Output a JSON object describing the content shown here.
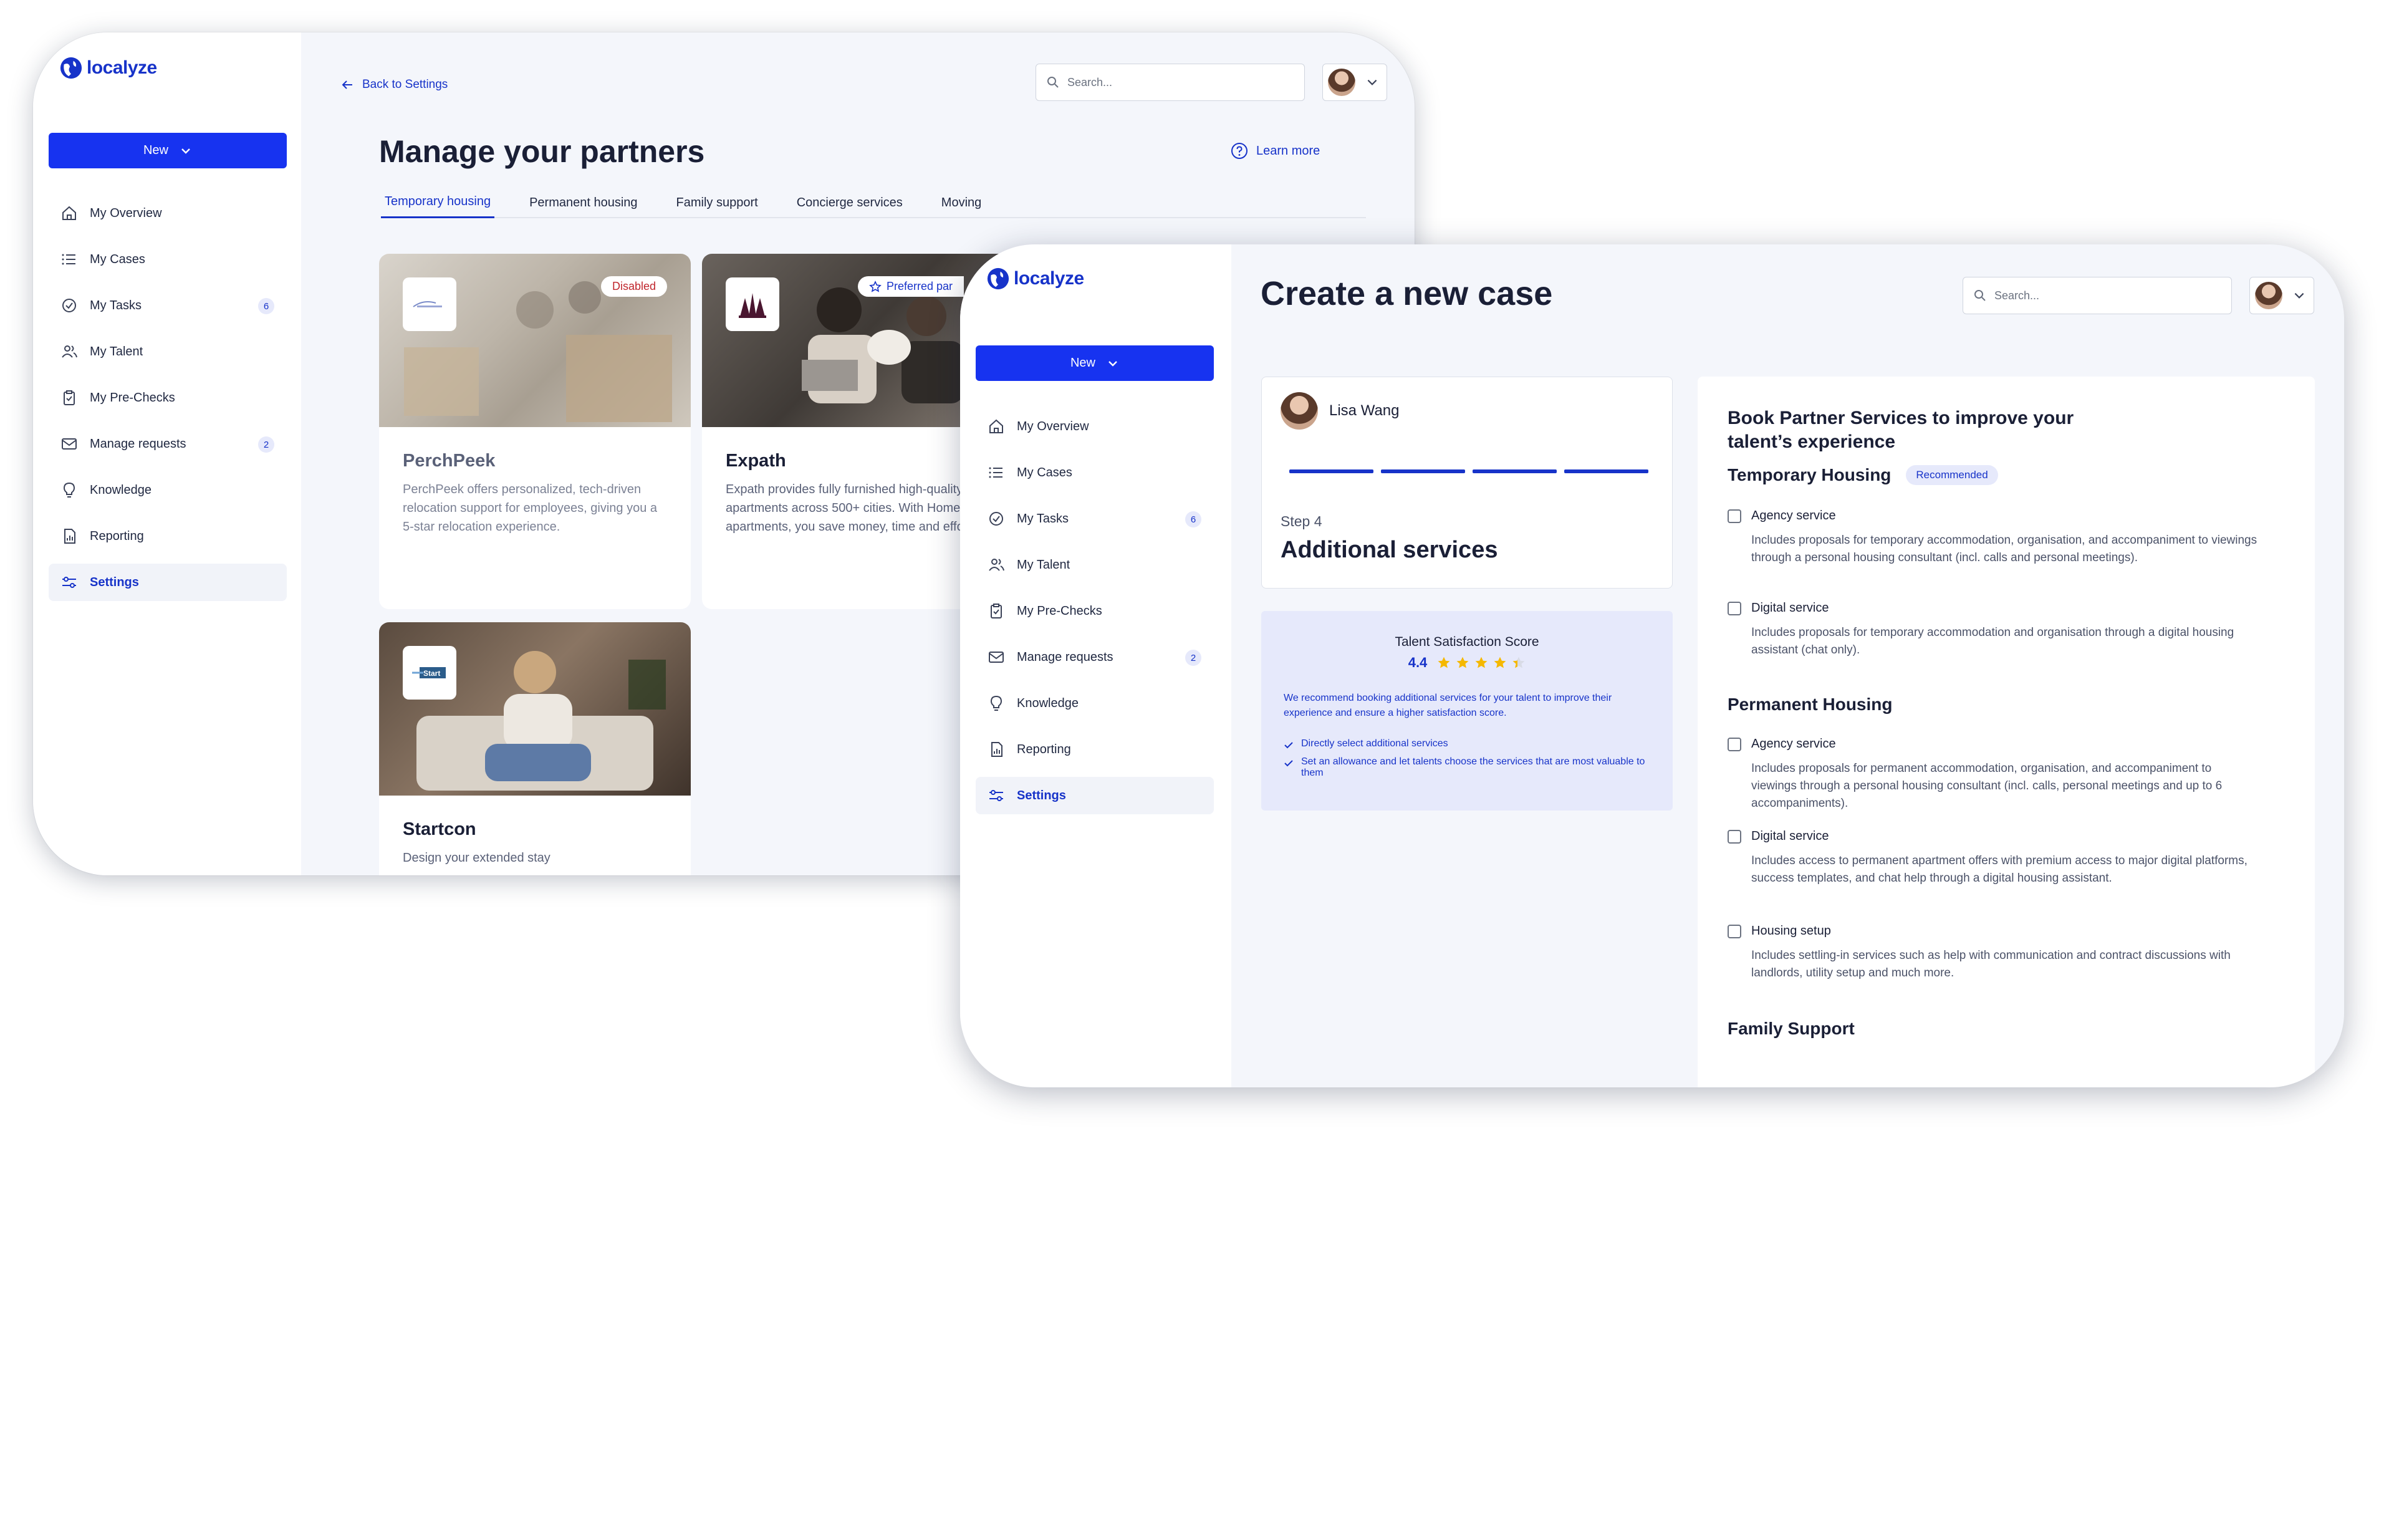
{
  "logo": "localyze",
  "colors": {
    "primary": "#1733f0",
    "accent": "#1733c9",
    "star": "#f5b800",
    "badge_bg": "#e6e9fb"
  },
  "back_window": {
    "new_button": "New",
    "nav": [
      {
        "label": "My Overview",
        "icon": "home-icon"
      },
      {
        "label": "My Cases",
        "icon": "list-icon"
      },
      {
        "label": "My Tasks",
        "icon": "check-circle-icon",
        "badge": "6"
      },
      {
        "label": "My Talent",
        "icon": "users-icon"
      },
      {
        "label": "My Pre-Checks",
        "icon": "clipboard-icon"
      },
      {
        "label": "Manage requests",
        "icon": "mail-icon",
        "badge": "2"
      },
      {
        "label": "Knowledge",
        "icon": "lightbulb-icon"
      },
      {
        "label": "Reporting",
        "icon": "report-icon"
      },
      {
        "label": "Settings",
        "icon": "sliders-icon",
        "active": true
      }
    ],
    "back_link": "Back to Settings",
    "search_placeholder": "Search...",
    "title": "Manage your partners",
    "learn_more": "Learn more",
    "tabs": [
      "Temporary housing",
      "Permanent housing",
      "Family support",
      "Concierge services",
      "Moving"
    ],
    "cards": [
      {
        "name": "PerchPeek",
        "badge": "Disabled",
        "desc": "PerchPeek offers personalized, tech-driven relocation support for employees, giving you a 5-star relocation experience."
      },
      {
        "name": "Expath",
        "badge": "Preferred par",
        "desc": "Expath provides fully furnished high-quality apartments across 500+ cities. With Homelike's apartments, you save money, time and effort."
      },
      {
        "name": "Startcon",
        "badge": "",
        "desc": "Design your extended stay"
      }
    ]
  },
  "front_window": {
    "new_button": "New",
    "nav": [
      {
        "label": "My Overview",
        "icon": "home-icon"
      },
      {
        "label": "My Cases",
        "icon": "list-icon"
      },
      {
        "label": "My Tasks",
        "icon": "check-circle-icon",
        "badge": "6"
      },
      {
        "label": "My Talent",
        "icon": "users-icon"
      },
      {
        "label": "My Pre-Checks",
        "icon": "clipboard-icon"
      },
      {
        "label": "Manage requests",
        "icon": "mail-icon",
        "badge": "2"
      },
      {
        "label": "Knowledge",
        "icon": "lightbulb-icon"
      },
      {
        "label": "Reporting",
        "icon": "report-icon"
      },
      {
        "label": "Settings",
        "icon": "sliders-icon",
        "active": true
      }
    ],
    "title": "Create a new case",
    "search_placeholder": "Search...",
    "talent_name": "Lisa Wang",
    "progress_steps_completed": 4,
    "step_label": "Step 4",
    "step_title": "Additional services",
    "score": {
      "title": "Talent Satisfaction Score",
      "value": "4.4",
      "stars": 4.4,
      "text": "We recommend booking additional services for your talent to improve their experience and ensure a higher satisfaction score.",
      "checks": [
        "Directly select additional services",
        "Set an allowance and let talents choose the services that are most valuable to them"
      ]
    },
    "services": {
      "heading": "Book Partner Services to improve your talent’s experience",
      "sections": [
        {
          "title": "Temporary Housing",
          "badge": "Recommended",
          "options": [
            {
              "label": "Agency service",
              "desc": "Includes proposals for temporary accommodation, organisation, and accompaniment to viewings through a personal housing consultant (incl. calls and personal meetings)."
            },
            {
              "label": "Digital service",
              "desc": "Includes proposals for temporary accommodation and organisation through a digital housing assistant (chat only)."
            }
          ]
        },
        {
          "title": "Permanent Housing",
          "badge": "",
          "options": [
            {
              "label": "Agency service",
              "desc": "Includes proposals for permanent accommodation, organisation, and accompaniment to viewings through a personal housing consultant (incl. calls, personal meetings and up to 6 accompaniments)."
            },
            {
              "label": "Digital service",
              "desc": "Includes access to permanent apartment offers with premium access to major digital platforms, success templates, and chat help through a digital housing assistant."
            },
            {
              "label": "Housing setup",
              "desc": "Includes settling-in services such as help with communication and contract discussions with landlords, utility setup and much more."
            }
          ]
        },
        {
          "title": "Family Support",
          "badge": "",
          "options": []
        }
      ]
    }
  }
}
